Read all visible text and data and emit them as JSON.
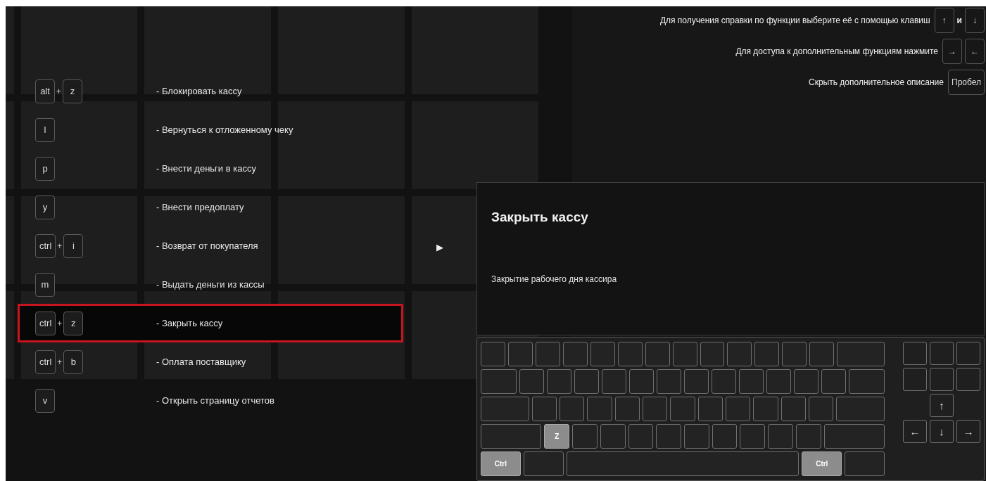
{
  "hints": [
    {
      "text": "Для получения справки по функции выберите её с помощью клавиш",
      "keys": [
        "↑",
        "↓"
      ],
      "joiner": "и"
    },
    {
      "text": "Для доступа к дополнительным функциям нажмите",
      "keys": [
        "→",
        "←"
      ]
    },
    {
      "text": "Скрыть дополнительное описание",
      "keys": [
        "Пробел"
      ]
    }
  ],
  "shortcuts": [
    {
      "keys": [
        "alt",
        "z"
      ],
      "joiner": "+",
      "description": "- Блокировать кассу",
      "selected": false
    },
    {
      "keys": [
        "l"
      ],
      "description": "- Вернуться к отложенному чеку",
      "selected": false
    },
    {
      "keys": [
        "p"
      ],
      "description": "- Внести деньги в кассу",
      "selected": false
    },
    {
      "keys": [
        "y"
      ],
      "description": "- Внести предоплату",
      "selected": false
    },
    {
      "keys": [
        "ctrl",
        "i"
      ],
      "joiner": "+",
      "description": "- Возврат от покупателя",
      "selected": false
    },
    {
      "keys": [
        "m"
      ],
      "description": "- Выдать деньги из кассы",
      "selected": false
    },
    {
      "keys": [
        "ctrl",
        "z"
      ],
      "joiner": "+",
      "description": "- Закрыть кассу",
      "selected": true
    },
    {
      "keys": [
        "ctrl",
        "b"
      ],
      "joiner": "+",
      "description": "- Оплата поставщику",
      "selected": false
    },
    {
      "keys": [
        "v"
      ],
      "description": "- Открыть страницу отчетов",
      "selected": false
    }
  ],
  "pointer": "▶",
  "detail": {
    "title": "Закрыть кассу",
    "description": "Закрытие рабочего дня кассира"
  },
  "keyboard": {
    "main": [
      [
        {
          "kind": "key",
          "pressed": false
        },
        {
          "kind": "key",
          "pressed": false
        },
        {
          "kind": "key",
          "pressed": false
        },
        {
          "kind": "key",
          "pressed": false
        },
        {
          "kind": "key",
          "pressed": false
        },
        {
          "kind": "key",
          "pressed": false
        },
        {
          "kind": "key",
          "pressed": false
        },
        {
          "kind": "key",
          "pressed": false
        },
        {
          "kind": "key",
          "pressed": false
        },
        {
          "kind": "key",
          "pressed": false
        },
        {
          "kind": "key",
          "pressed": false
        },
        {
          "kind": "key",
          "pressed": false
        },
        {
          "kind": "key",
          "pressed": false
        },
        {
          "kind": "caps",
          "pressed": false
        }
      ],
      [
        {
          "kind": "tab",
          "pressed": false
        },
        {
          "kind": "key",
          "pressed": false
        },
        {
          "kind": "key",
          "pressed": false
        },
        {
          "kind": "key",
          "pressed": false
        },
        {
          "kind": "key",
          "pressed": false
        },
        {
          "kind": "key",
          "pressed": false
        },
        {
          "kind": "key",
          "pressed": false
        },
        {
          "kind": "key",
          "pressed": false
        },
        {
          "kind": "key",
          "pressed": false
        },
        {
          "kind": "key",
          "pressed": false
        },
        {
          "kind": "key",
          "pressed": false
        },
        {
          "kind": "key",
          "pressed": false
        },
        {
          "kind": "key",
          "pressed": false
        },
        {
          "kind": "tab",
          "pressed": false
        }
      ],
      [
        {
          "kind": "caps",
          "pressed": false
        },
        {
          "kind": "key",
          "pressed": false
        },
        {
          "kind": "key",
          "pressed": false
        },
        {
          "kind": "key",
          "pressed": false
        },
        {
          "kind": "key",
          "pressed": false
        },
        {
          "kind": "key",
          "pressed": false
        },
        {
          "kind": "key",
          "pressed": false
        },
        {
          "kind": "key",
          "pressed": false
        },
        {
          "kind": "key",
          "pressed": false
        },
        {
          "kind": "key",
          "pressed": false
        },
        {
          "kind": "key",
          "pressed": false
        },
        {
          "kind": "key",
          "pressed": false
        },
        {
          "kind": "caps",
          "pressed": false
        }
      ],
      [
        {
          "kind": "shift",
          "pressed": false
        },
        {
          "kind": "key",
          "label": "Z",
          "pressed": true
        },
        {
          "kind": "key",
          "pressed": false
        },
        {
          "kind": "key",
          "pressed": false
        },
        {
          "kind": "key",
          "pressed": false
        },
        {
          "kind": "key",
          "pressed": false
        },
        {
          "kind": "key",
          "pressed": false
        },
        {
          "kind": "key",
          "pressed": false
        },
        {
          "kind": "key",
          "pressed": false
        },
        {
          "kind": "key",
          "pressed": false
        },
        {
          "kind": "key",
          "pressed": false
        },
        {
          "kind": "shift",
          "pressed": false
        }
      ],
      [
        {
          "kind": "mod",
          "label": "Ctrl",
          "pressed": true
        },
        {
          "kind": "mod",
          "pressed": false
        },
        {
          "kind": "space",
          "pressed": false
        },
        {
          "kind": "mod",
          "label": "Ctrl",
          "pressed": true
        },
        {
          "kind": "mod",
          "pressed": false
        }
      ]
    ],
    "nav": [
      [
        {
          "kind": "key",
          "pressed": false
        },
        {
          "kind": "key",
          "pressed": false
        },
        {
          "kind": "key",
          "pressed": false
        }
      ],
      [
        {
          "kind": "key",
          "pressed": false
        },
        {
          "kind": "key",
          "pressed": false
        },
        {
          "kind": "key",
          "pressed": false
        }
      ],
      [
        {
          "kind": "empty"
        },
        {
          "kind": "empty"
        },
        {
          "kind": "empty"
        }
      ],
      [
        {
          "kind": "empty"
        },
        {
          "kind": "key",
          "label": "↑",
          "pressed": false
        },
        {
          "kind": "empty"
        }
      ],
      [
        {
          "kind": "key",
          "label": "←",
          "pressed": false
        },
        {
          "kind": "key",
          "label": "↓",
          "pressed": false
        },
        {
          "kind": "key",
          "label": "→",
          "pressed": false
        }
      ]
    ]
  }
}
